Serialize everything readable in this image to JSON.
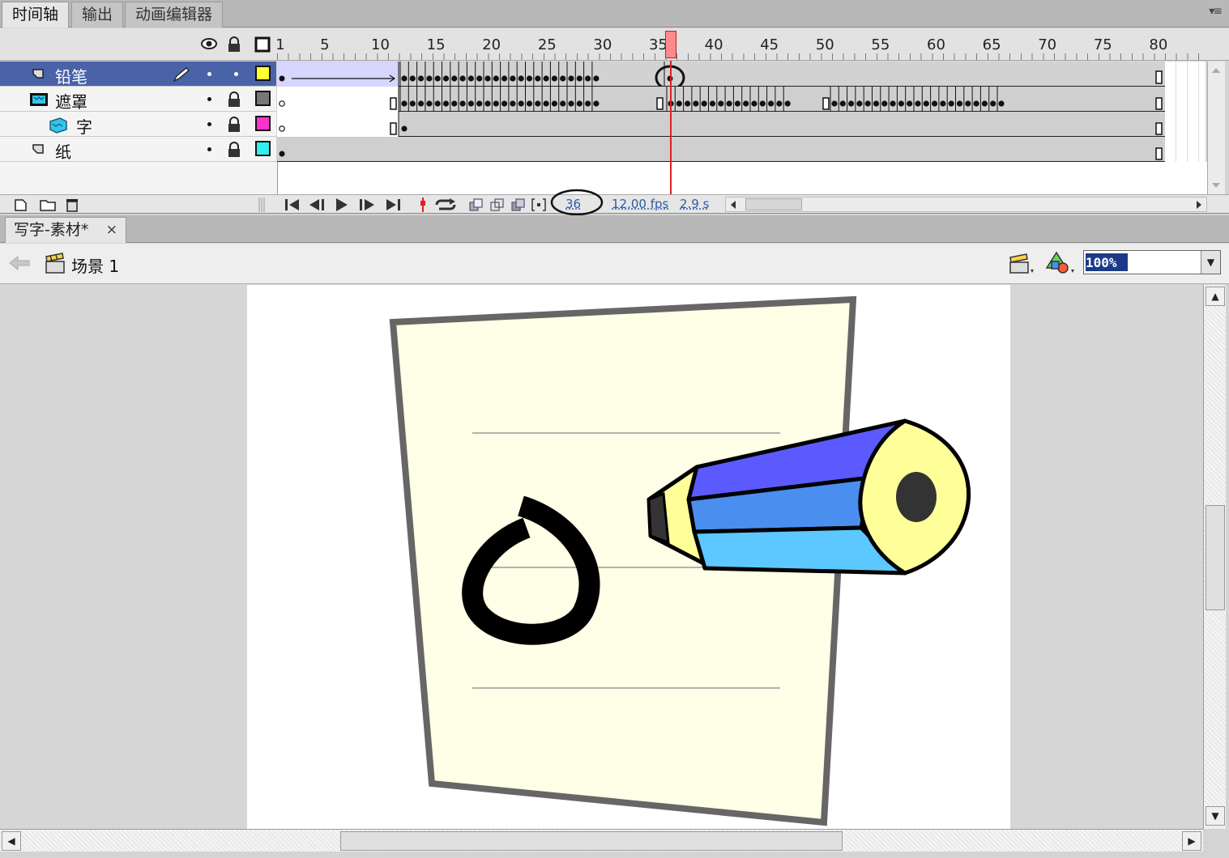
{
  "timeline_panel": {
    "tabs": [
      {
        "label": "时间轴",
        "active": true
      },
      {
        "label": "输出",
        "active": false
      },
      {
        "label": "动画编辑器",
        "active": false
      }
    ],
    "menu_glyph": "▾≡",
    "frame_numbers": [
      "1",
      "5",
      "10",
      "15",
      "20",
      "25",
      "30",
      "35",
      "40",
      "45",
      "50",
      "55",
      "60",
      "65",
      "70",
      "75",
      "80"
    ],
    "layers": [
      {
        "name": "铅笔",
        "selected": true,
        "color": "#ffff33"
      },
      {
        "name": "遮罩",
        "selected": false,
        "color": "#777777"
      },
      {
        "name": "字",
        "selected": false,
        "color": "#ff33cc"
      },
      {
        "name": "纸",
        "selected": false,
        "color": "#33eeee"
      }
    ],
    "current_frame": "36",
    "fps": "12.00 fps",
    "elapsed": "2.9 s"
  },
  "document": {
    "tab_label": "写字-素材*",
    "tab_close": "×",
    "scene_label": "场景 1",
    "zoom": "100%"
  },
  "colors": {
    "playhead": "#e02020",
    "selected_layer": "#4a62a8",
    "tween_fill": "#d7d6ff",
    "paper_fill": "#fffee6",
    "pencil_dark": "#5a5aff",
    "pencil_mid": "#4a8ef0",
    "pencil_light": "#5cc8ff",
    "pencil_wood": "#ffff99"
  }
}
